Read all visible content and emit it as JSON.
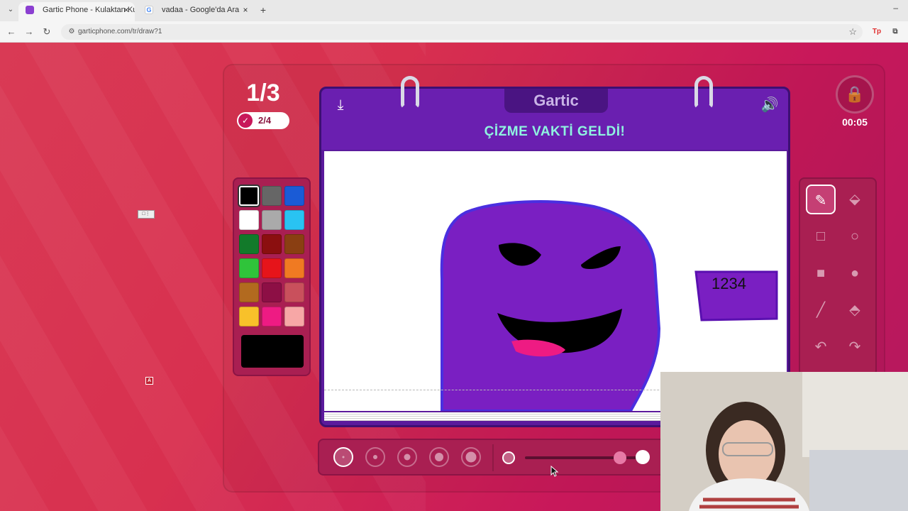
{
  "browser": {
    "tabs": [
      {
        "title": "Gartic Phone - Kulaktan Kulağa",
        "favicon": "gartic-favicon",
        "active": true
      },
      {
        "title": "vadaa - Google'da Ara",
        "favicon": "google-favicon",
        "active": false
      }
    ],
    "url": "garticphone.com/tr/draw?1"
  },
  "game": {
    "round": "1/3",
    "players_done": "2/4",
    "timer": "00:05",
    "logo": "Gartic",
    "title": "ÇİZME VAKTİ GELDİ!",
    "canvas_text": "1234"
  },
  "palette": {
    "colors": [
      "#000000",
      "#666666",
      "#1a5bd6",
      "#ffffff",
      "#aaaaaa",
      "#29c3f2",
      "#127a2a",
      "#8b0f0f",
      "#8a3f12",
      "#2fc43a",
      "#e6141a",
      "#f07a22",
      "#b26a1f",
      "#8d0f45",
      "#c9505c",
      "#f8c12a",
      "#ee1b83",
      "#f7a7a6"
    ],
    "selected": "#000000",
    "current": "#000000"
  },
  "tools": [
    {
      "name": "pencil-icon",
      "active": true
    },
    {
      "name": "eraser-icon",
      "active": false
    },
    {
      "name": "rectangle-outline-icon",
      "active": false
    },
    {
      "name": "circle-outline-icon",
      "active": false
    },
    {
      "name": "rectangle-filled-icon",
      "active": false
    },
    {
      "name": "circle-filled-icon",
      "active": false
    },
    {
      "name": "line-icon",
      "active": false
    },
    {
      "name": "fill-bucket-icon",
      "active": false
    },
    {
      "name": "undo-icon",
      "active": false
    },
    {
      "name": "redo-icon",
      "active": false
    }
  ],
  "brush": {
    "sizes": 5,
    "active_size": 1,
    "opacity": 0.84
  },
  "theme": {
    "accent": "#c8185a",
    "notebook": "#5b1a9c",
    "title_color": "#8ff3e0"
  }
}
